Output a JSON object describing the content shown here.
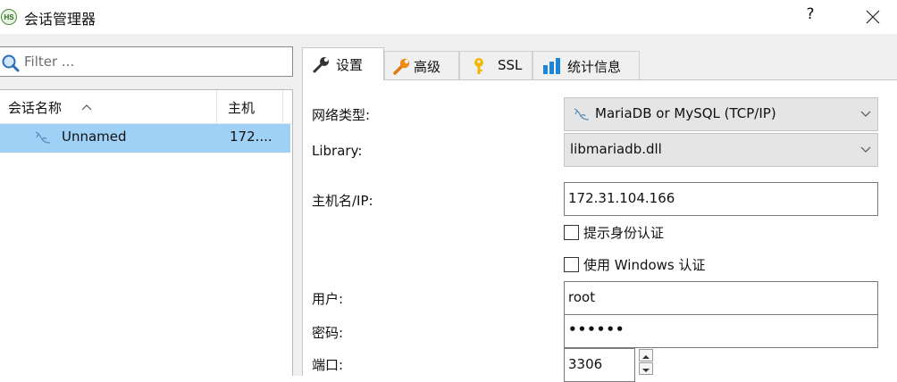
{
  "window": {
    "icon_text": "HS",
    "title": "会话管理器",
    "help_label": "?"
  },
  "filter": {
    "placeholder": "Filter ..."
  },
  "session_list": {
    "columns": [
      {
        "label": "会话名称",
        "sort": "ascending"
      },
      {
        "label": "主机"
      }
    ],
    "rows": [
      {
        "name": "Unnamed",
        "host": "172....",
        "selected": true,
        "icon": "dolphin-icon"
      }
    ]
  },
  "tabs": [
    {
      "label": "设置",
      "icon": "wrench-icon",
      "active": true
    },
    {
      "label": "高级",
      "icon": "wrench-orange-icon"
    },
    {
      "label": "SSL",
      "icon": "key-icon"
    },
    {
      "label": "统计信息",
      "icon": "bar-chart-icon"
    }
  ],
  "settings": {
    "network_type_label": "网络类型:",
    "network_type_value": "MariaDB or MySQL (TCP/IP)",
    "library_label": "Library:",
    "library_value": "libmariadb.dll",
    "host_label": "主机名/IP:",
    "host_value": "172.31.104.166",
    "prompt_auth_label": "提示身份认证",
    "prompt_auth_checked": false,
    "windows_auth_label": "使用 Windows 认证",
    "windows_auth_checked": false,
    "user_label": "用户:",
    "user_value": "root",
    "password_label": "密码:",
    "password_value": "••••••",
    "port_label": "端口:",
    "port_value": "3306"
  },
  "colors": {
    "selected_row": "#9fd1f7",
    "panel_bg": "#f0f0f0",
    "dropdown_bg": "#e5e5e5"
  }
}
